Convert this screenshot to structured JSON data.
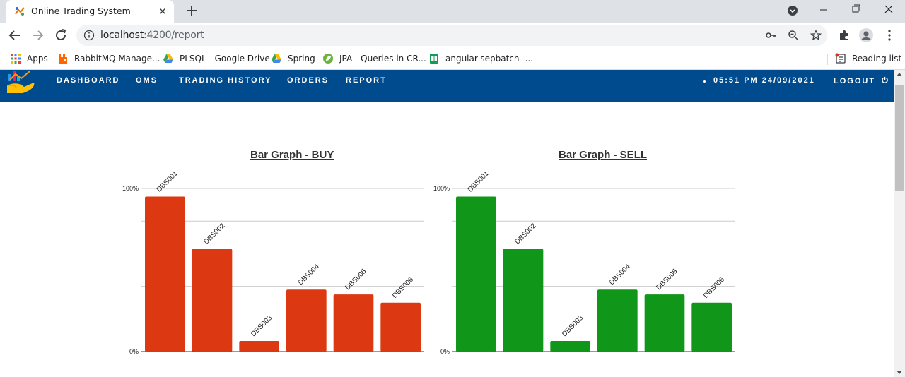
{
  "browser": {
    "tab_title": "Online Trading System",
    "url_host": "localhost",
    "url_path": ":4200/report",
    "bookmarks": [
      {
        "label": "Apps",
        "icon": "apps-grid-icon"
      },
      {
        "label": "RabbitMQ Manage...",
        "icon": "rabbitmq-icon"
      },
      {
        "label": "PLSQL - Google Drive",
        "icon": "google-drive-icon"
      },
      {
        "label": "Spring",
        "icon": "google-drive-icon"
      },
      {
        "label": "JPA - Queries in CR...",
        "icon": "spring-leaf-icon"
      },
      {
        "label": "angular-sepbatch -...",
        "icon": "google-sheets-icon"
      }
    ],
    "reading_list": "Reading list"
  },
  "nav": {
    "items": [
      "DASHBOARD",
      "OMS",
      "TRADING HISTORY",
      "ORDERS",
      "REPORT"
    ],
    "datetime": "05:51 PM 24/09/2021",
    "logout": "LOGOUT",
    "bg_color": "#004b8d"
  },
  "chart_data": [
    {
      "type": "bar",
      "title": "Bar Graph - BUY",
      "categories": [
        "DBS001",
        "DBS002",
        "DBS003",
        "DBS004",
        "DBS005",
        "DBS006"
      ],
      "values": [
        95,
        63,
        6.5,
        38,
        35,
        30
      ],
      "ylim": [
        0,
        100
      ],
      "yticks": [
        "0%",
        "100%"
      ],
      "gridlines": [
        0,
        40,
        80,
        100
      ],
      "color": "#dc3912"
    },
    {
      "type": "bar",
      "title": "Bar Graph - SELL",
      "categories": [
        "DBS001",
        "DBS002",
        "DBS003",
        "DBS004",
        "DBS005",
        "DBS006"
      ],
      "values": [
        95,
        63,
        6.5,
        38,
        35,
        30
      ],
      "ylim": [
        0,
        100
      ],
      "yticks": [
        "0%",
        "100%"
      ],
      "gridlines": [
        0,
        40,
        80,
        100
      ],
      "color": "#109618"
    }
  ]
}
